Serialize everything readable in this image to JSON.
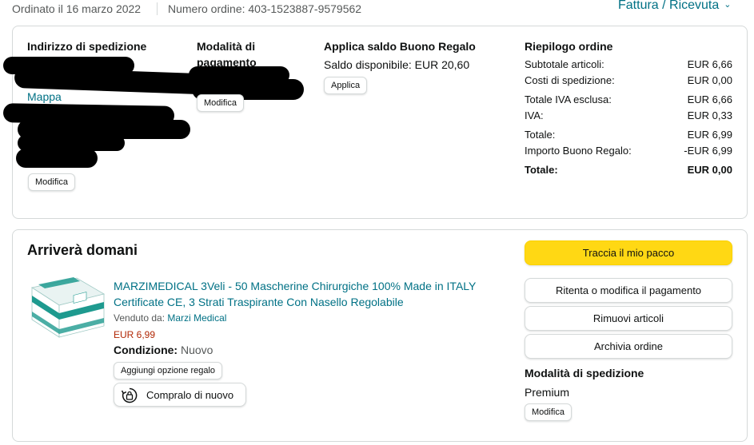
{
  "colors": {
    "link": "#007185",
    "price": "#B12704",
    "primary_button": "#FFD814",
    "border": "#D5D9D9",
    "text": "#0F1111",
    "muted": "#565959"
  },
  "header": {
    "order_date": "Ordinato il 16 marzo 2022",
    "order_number": "Numero ordine: 403-1523887-9579562",
    "invoice_link": "Fattura / Ricevuta",
    "invoice_icon": "chevron-down-icon"
  },
  "shipping_address": {
    "title": "Indirizzo di spedizione",
    "map_link": "Mappa",
    "modify_label": "Modifica"
  },
  "payment_method": {
    "title_line1": "Modalità di",
    "title_line2": "pagamento",
    "modify_label": "Modifica"
  },
  "gift_card": {
    "title": "Applica saldo Buono Regalo",
    "balance": "Saldo disponibile: EUR 20,60",
    "apply_label": "Applica"
  },
  "summary": {
    "title": "Riepilogo ordine",
    "rows": [
      {
        "label": "Subtotale articoli:",
        "value": "EUR 6,66"
      },
      {
        "label": "Costi di spedizione:",
        "value": "EUR 0,00"
      },
      {
        "label": "Totale IVA esclusa:",
        "value": "EUR 6,66"
      },
      {
        "label": "IVA:",
        "value": "EUR 0,33"
      },
      {
        "label": "Totale:",
        "value": "EUR 6,99"
      },
      {
        "label": "Importo Buono Regalo:",
        "value": "-EUR 6,99"
      },
      {
        "label": "Totale:",
        "value": "EUR 0,00"
      }
    ]
  },
  "shipment": {
    "title": "Arriverà domani",
    "product": {
      "title": "MARZIMEDICAL 3Veli - 50 Mascherine Chirurgiche 100% Made in ITALY Certificate CE, 3 Strati Traspirante Con Nasello Regolabile",
      "sold_by_label": "Venduto da:",
      "seller": "Marzi Medical",
      "price": "EUR 6,99",
      "condition_label": "Condizione:",
      "condition_value": "Nuovo",
      "gift_option_label": "Aggiungi opzione regalo",
      "buy_again_label": "Compralo di nuovo",
      "buy_again_icon": "buy-again-icon"
    },
    "actions": {
      "track": "Traccia il mio pacco",
      "retry_payment": "Ritenta o modifica il pagamento",
      "remove_items": "Rimuovi articoli",
      "archive": "Archivia ordine"
    },
    "shipping_method": {
      "title": "Modalità di spedizione",
      "value": "Premium",
      "modify_label": "Modifica"
    }
  }
}
